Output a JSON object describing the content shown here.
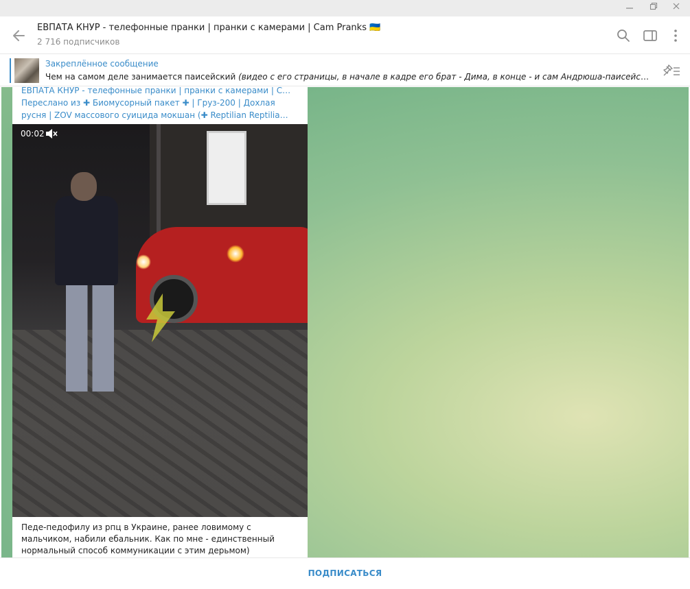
{
  "window": {
    "minimize_icon": "minimize-icon",
    "restore_icon": "restore-icon",
    "close_icon": "close-icon"
  },
  "header": {
    "title": "ЕВПАТА КНУР - телефонные пранки | пранки с камерами | Cam Pranks 🇺🇦",
    "subscribers": "2 716 подписчиков",
    "back_icon": "arrow-left-icon",
    "search_icon": "search-icon",
    "sidebar_icon": "sidebar-toggle-icon",
    "more_icon": "more-vertical-icon"
  },
  "pinned": {
    "label": "Закреплённое сообщение",
    "text_plain": "Чем на самом деле занимается паисейский ",
    "text_italic": "(видео с его страницы, в начале в кадре его брат - Дима, в конце - и сам Андрюша-паисейский, ве…",
    "icon": "pin-list-icon"
  },
  "message": {
    "author": "ЕВПАТА КНУР - телефонные пранки | пранки с камерами | C…",
    "forwarded_line1": "Переслано из ✚ Биомусорный пакет ✚ | Груз-200 | Дохлая",
    "forwarded_line2": "русня | ZOV массового суицида мокшан (✚ Reptilian Reptilia…",
    "video_time": "00:02",
    "caption": "Педе-педофилу из рпц в Украине, ранее ловимому с мальчиком, набили ебальник. Как по мне - единственный нормальный способ коммуникации с этим дерьмом)"
  },
  "footer": {
    "subscribe_label": "ПОДПИСАТЬСЯ"
  },
  "colors": {
    "accent": "#3a8cc9",
    "chat_bg": "#8fc093"
  }
}
